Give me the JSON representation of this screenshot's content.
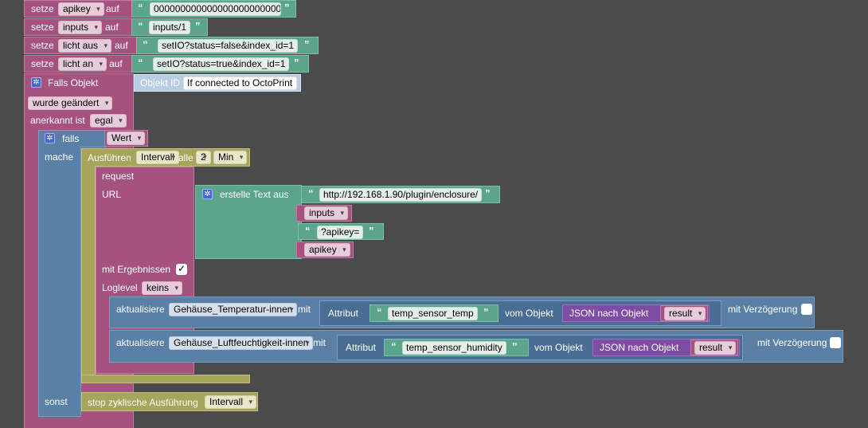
{
  "rows": [
    {
      "verb": "setze",
      "var": "apikey",
      "on": "auf",
      "value": "000000000000000000000000"
    },
    {
      "verb": "setze",
      "var": "inputs",
      "on": "auf",
      "value": "inputs/1"
    },
    {
      "verb": "setze",
      "var": "licht aus",
      "on": "auf",
      "value": "setIO?status=false&index_id=1"
    },
    {
      "verb": "setze",
      "var": "licht an",
      "on": "auf",
      "value": "setIO?status=true&index_id=1"
    }
  ],
  "trigger": {
    "label": "Falls Objekt",
    "objid_label": "Objekt ID",
    "objid_value": "If connected to OctoPrint",
    "changed": "wurde geändert",
    "ack_label": "anerkannt ist",
    "ack_value": "egal"
  },
  "ifblock": {
    "falls": "falls",
    "wert": "Wert",
    "mache": "mache",
    "sonst": "sonst"
  },
  "interval": {
    "label": "Ausführen",
    "name": "Intervall",
    "alle": "alle",
    "num": "2",
    "unit": "Min"
  },
  "request": {
    "label": "request",
    "url": "URL",
    "text_label": "erstelle Text aus",
    "url_value": "http://192.168.1.90/plugin/enclosure/",
    "inputs": "inputs",
    "apikey_text": "?apikey=",
    "apikey_var": "apikey",
    "results": "mit Ergebnissen",
    "results_check": "✓",
    "loglevel": "Loglevel",
    "loglevel_value": "keins"
  },
  "updates": [
    {
      "label": "aktualisiere",
      "obj": "Gehäuse_Temperatur-innen",
      "mit": "mit",
      "attr": "Attribut",
      "attr_value": "temp_sensor_temp",
      "vom": "vom Objekt",
      "json": "JSON nach Objekt",
      "result": "result",
      "delay": "mit Verzögerung"
    },
    {
      "label": "aktualisiere",
      "obj": "Gehäuse_Luftfeuchtigkeit-innen",
      "mit": "mit",
      "attr": "Attribut",
      "attr_value": "temp_sensor_humidity",
      "vom": "vom Objekt",
      "json": "JSON nach Objekt",
      "result": "result",
      "delay": "mit Verzögerung"
    }
  ],
  "stop": {
    "label": "stop zyklische Ausführung",
    "name": "Intervall"
  },
  "colors": {
    "background": "#4b4b4b",
    "variables": "#a5527f",
    "logic": "#5b80a5",
    "text": "#5ba58c",
    "timer": "#a5a55b",
    "convert": "#7e4ca5"
  }
}
